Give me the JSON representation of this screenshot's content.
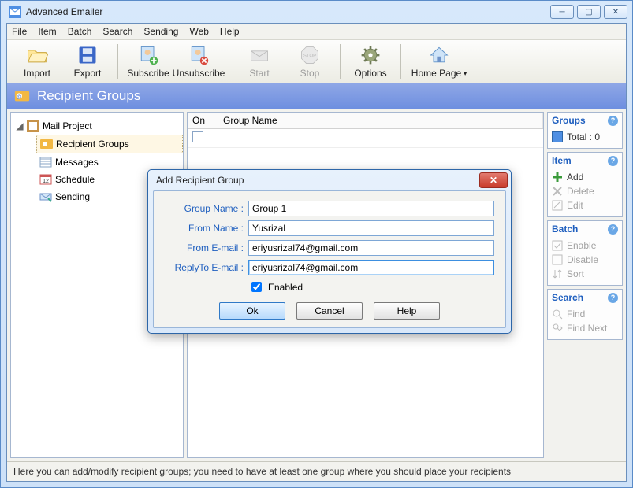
{
  "app": {
    "title": "Advanced Emailer"
  },
  "menu": {
    "file": "File",
    "item": "Item",
    "batch": "Batch",
    "search": "Search",
    "sending": "Sending",
    "web": "Web",
    "help": "Help"
  },
  "toolbar": {
    "import": "Import",
    "export": "Export",
    "subscribe": "Subscribe",
    "unsubscribe": "Unsubscribe",
    "start": "Start",
    "stop": "Stop",
    "options": "Options",
    "homepage": "Home Page"
  },
  "header": {
    "title": "Recipient Groups"
  },
  "tree": {
    "root": "Mail Project",
    "recipient_groups": "Recipient Groups",
    "messages": "Messages",
    "schedule": "Schedule",
    "sending": "Sending"
  },
  "grid": {
    "col_on": "On",
    "col_group": "Group Name"
  },
  "side": {
    "groups": {
      "title": "Groups",
      "total": "Total : 0"
    },
    "item": {
      "title": "Item",
      "add": "Add",
      "delete": "Delete",
      "edit": "Edit"
    },
    "batch": {
      "title": "Batch",
      "enable": "Enable",
      "disable": "Disable",
      "sort": "Sort"
    },
    "search": {
      "title": "Search",
      "find": "Find",
      "findnext": "Find Next"
    }
  },
  "status": "Here you can add/modify recipient groups; you need to have at least one group where you should place your recipients",
  "dialog": {
    "title": "Add Recipient Group",
    "labels": {
      "group_name": "Group Name :",
      "from_name": "From Name :",
      "from_email": "From E-mail :",
      "replyto": "ReplyTo E-mail :",
      "enabled": "Enabled"
    },
    "values": {
      "group_name": "Group 1",
      "from_name": "Yusrizal",
      "from_email": "eriyusrizal74@gmail.com",
      "replyto": "eriyusrizal74@gmail.com"
    },
    "enabled": true,
    "buttons": {
      "ok": "Ok",
      "cancel": "Cancel",
      "help": "Help"
    }
  }
}
